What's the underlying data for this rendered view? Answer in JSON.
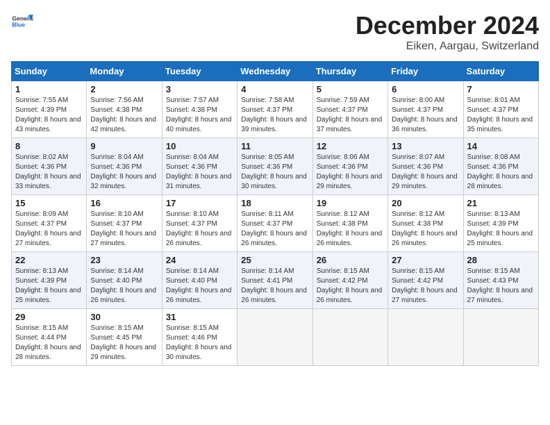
{
  "header": {
    "logo_general": "General",
    "logo_blue": "Blue",
    "month": "December 2024",
    "location": "Eiken, Aargau, Switzerland"
  },
  "days_of_week": [
    "Sunday",
    "Monday",
    "Tuesday",
    "Wednesday",
    "Thursday",
    "Friday",
    "Saturday"
  ],
  "weeks": [
    [
      {
        "day": "1",
        "sunrise": "7:55 AM",
        "sunset": "4:39 PM",
        "daylight": "8 hours and 43 minutes."
      },
      {
        "day": "2",
        "sunrise": "7:56 AM",
        "sunset": "4:38 PM",
        "daylight": "8 hours and 42 minutes."
      },
      {
        "day": "3",
        "sunrise": "7:57 AM",
        "sunset": "4:38 PM",
        "daylight": "8 hours and 40 minutes."
      },
      {
        "day": "4",
        "sunrise": "7:58 AM",
        "sunset": "4:37 PM",
        "daylight": "8 hours and 39 minutes."
      },
      {
        "day": "5",
        "sunrise": "7:59 AM",
        "sunset": "4:37 PM",
        "daylight": "8 hours and 37 minutes."
      },
      {
        "day": "6",
        "sunrise": "8:00 AM",
        "sunset": "4:37 PM",
        "daylight": "8 hours and 36 minutes."
      },
      {
        "day": "7",
        "sunrise": "8:01 AM",
        "sunset": "4:37 PM",
        "daylight": "8 hours and 35 minutes."
      }
    ],
    [
      {
        "day": "8",
        "sunrise": "8:02 AM",
        "sunset": "4:36 PM",
        "daylight": "8 hours and 33 minutes."
      },
      {
        "day": "9",
        "sunrise": "8:04 AM",
        "sunset": "4:36 PM",
        "daylight": "8 hours and 32 minutes."
      },
      {
        "day": "10",
        "sunrise": "8:04 AM",
        "sunset": "4:36 PM",
        "daylight": "8 hours and 31 minutes."
      },
      {
        "day": "11",
        "sunrise": "8:05 AM",
        "sunset": "4:36 PM",
        "daylight": "8 hours and 30 minutes."
      },
      {
        "day": "12",
        "sunrise": "8:06 AM",
        "sunset": "4:36 PM",
        "daylight": "8 hours and 29 minutes."
      },
      {
        "day": "13",
        "sunrise": "8:07 AM",
        "sunset": "4:36 PM",
        "daylight": "8 hours and 29 minutes."
      },
      {
        "day": "14",
        "sunrise": "8:08 AM",
        "sunset": "4:36 PM",
        "daylight": "8 hours and 28 minutes."
      }
    ],
    [
      {
        "day": "15",
        "sunrise": "8:09 AM",
        "sunset": "4:37 PM",
        "daylight": "8 hours and 27 minutes."
      },
      {
        "day": "16",
        "sunrise": "8:10 AM",
        "sunset": "4:37 PM",
        "daylight": "8 hours and 27 minutes."
      },
      {
        "day": "17",
        "sunrise": "8:10 AM",
        "sunset": "4:37 PM",
        "daylight": "8 hours and 26 minutes."
      },
      {
        "day": "18",
        "sunrise": "8:11 AM",
        "sunset": "4:37 PM",
        "daylight": "8 hours and 26 minutes."
      },
      {
        "day": "19",
        "sunrise": "8:12 AM",
        "sunset": "4:38 PM",
        "daylight": "8 hours and 26 minutes."
      },
      {
        "day": "20",
        "sunrise": "8:12 AM",
        "sunset": "4:38 PM",
        "daylight": "8 hours and 26 minutes."
      },
      {
        "day": "21",
        "sunrise": "8:13 AM",
        "sunset": "4:39 PM",
        "daylight": "8 hours and 25 minutes."
      }
    ],
    [
      {
        "day": "22",
        "sunrise": "8:13 AM",
        "sunset": "4:39 PM",
        "daylight": "8 hours and 25 minutes."
      },
      {
        "day": "23",
        "sunrise": "8:14 AM",
        "sunset": "4:40 PM",
        "daylight": "8 hours and 26 minutes."
      },
      {
        "day": "24",
        "sunrise": "8:14 AM",
        "sunset": "4:40 PM",
        "daylight": "8 hours and 26 minutes."
      },
      {
        "day": "25",
        "sunrise": "8:14 AM",
        "sunset": "4:41 PM",
        "daylight": "8 hours and 26 minutes."
      },
      {
        "day": "26",
        "sunrise": "8:15 AM",
        "sunset": "4:42 PM",
        "daylight": "8 hours and 26 minutes."
      },
      {
        "day": "27",
        "sunrise": "8:15 AM",
        "sunset": "4:42 PM",
        "daylight": "8 hours and 27 minutes."
      },
      {
        "day": "28",
        "sunrise": "8:15 AM",
        "sunset": "4:43 PM",
        "daylight": "8 hours and 27 minutes."
      }
    ],
    [
      {
        "day": "29",
        "sunrise": "8:15 AM",
        "sunset": "4:44 PM",
        "daylight": "8 hours and 28 minutes."
      },
      {
        "day": "30",
        "sunrise": "8:15 AM",
        "sunset": "4:45 PM",
        "daylight": "8 hours and 29 minutes."
      },
      {
        "day": "31",
        "sunrise": "8:15 AM",
        "sunset": "4:46 PM",
        "daylight": "8 hours and 30 minutes."
      },
      null,
      null,
      null,
      null
    ]
  ]
}
